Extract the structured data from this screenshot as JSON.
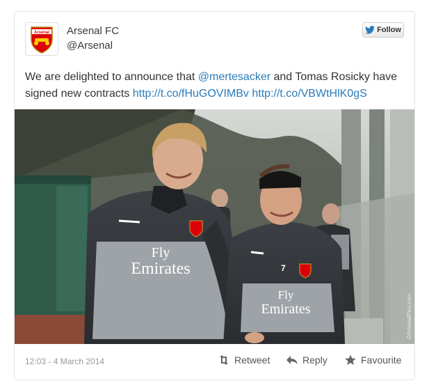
{
  "account": {
    "name": "Arsenal FC",
    "handle": "@Arsenal",
    "avatar_label": "Arsenal"
  },
  "follow": {
    "label": "Follow",
    "icon": "twitter-bird-icon",
    "color": "#2b7bb9"
  },
  "tweet": {
    "text_before": "We are delighted to announce that ",
    "mention": "@mertesacker",
    "text_after": " and Tomas Rosicky have signed new contracts ",
    "link1": "http://t.co/fHuGOVIMBv",
    "link2": "http://t.co/VBWtHlK0gS"
  },
  "photo": {
    "description_icon": "photo",
    "shirt_sponsor_top": "Fly",
    "shirt_sponsor_bottom": "Emirates",
    "shirt_number": "7",
    "watermark": "©ArsenalPics.com"
  },
  "footer": {
    "timestamp": "12:03 - 4 March 2014",
    "retweet_label": "Retweet",
    "reply_label": "Reply",
    "favourite_label": "Favourite"
  },
  "colors": {
    "link": "#2b7bb9",
    "arsenal_red": "#db0007"
  }
}
